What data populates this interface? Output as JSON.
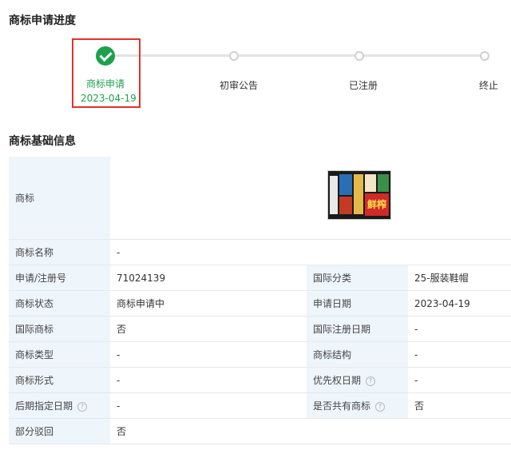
{
  "progress": {
    "title": "商标申请进度",
    "steps": [
      {
        "label": "商标申请",
        "date": "2023-04-19",
        "done": true
      },
      {
        "label": "初审公告"
      },
      {
        "label": "已注册"
      },
      {
        "label": "终止"
      }
    ],
    "done_color": "#1ea04c",
    "highlight_color": "#e0322b"
  },
  "info": {
    "title": "商标基础信息",
    "trademark_label": "商标",
    "trademark_image_text": "鲜榨",
    "rows": [
      {
        "l1": "商标名称",
        "v1": "-"
      },
      {
        "l1": "申请/注册号",
        "v1": "71024139",
        "l2": "国际分类",
        "v2": "25-服装鞋帽"
      },
      {
        "l1": "商标状态",
        "v1": "商标申请中",
        "l2": "申请日期",
        "v2": "2023-04-19"
      },
      {
        "l1": "国际商标",
        "v1": "否",
        "l2": "国际注册日期",
        "v2": "-"
      },
      {
        "l1": "商标类型",
        "v1": "-",
        "l2": "商标结构",
        "v2": "-"
      },
      {
        "l1": "商标形式",
        "v1": "-",
        "l2": "优先权日期",
        "v2": "-"
      },
      {
        "l1": "后期指定日期",
        "v1": "-",
        "l2": "是否共有商标",
        "v2": "否"
      },
      {
        "l1": "部分驳回",
        "v1": "否"
      }
    ],
    "help_glyph": "?"
  }
}
